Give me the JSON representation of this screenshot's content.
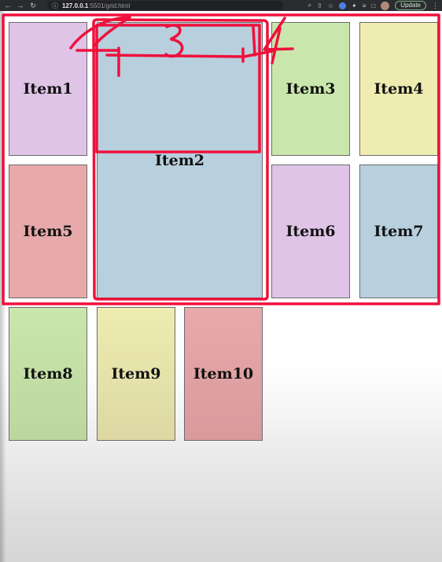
{
  "browser": {
    "url_host": "127.0.0.1",
    "url_path": ":5501/grid.html",
    "update_label": "Update",
    "icons": [
      "back-icon",
      "forward-icon",
      "reload-icon",
      "info-icon",
      "zoom-icon",
      "share-icon",
      "star-icon",
      "extension-icon",
      "puzzle-icon",
      "media-icon",
      "sidebar-icon",
      "avatar",
      "kebab-icon"
    ]
  },
  "grid": {
    "items": [
      "Item1",
      "Item2",
      "Item3",
      "Item4",
      "Item5",
      "Item6",
      "Item7",
      "Item8",
      "Item9",
      "Item10"
    ],
    "colors": {
      "purple": "#dfc4e7",
      "blue": "#b8cfdd",
      "green": "#c9e7ac",
      "yellow": "#eeecb1",
      "red": "#e7a9aa"
    }
  },
  "annotations": {
    "color": "#f0103c",
    "digits": [
      "2",
      "3",
      "4"
    ]
  }
}
